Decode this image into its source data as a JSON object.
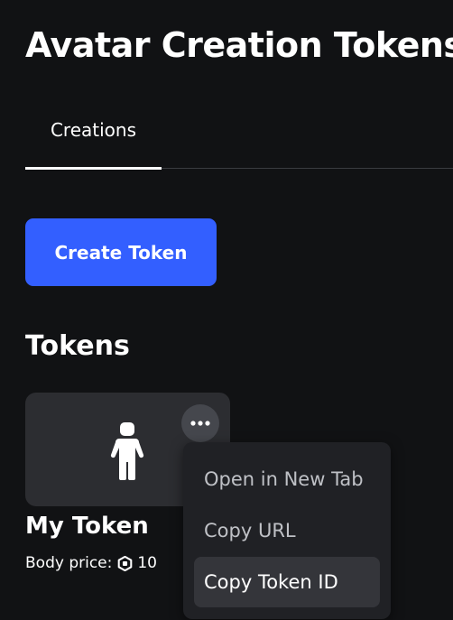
{
  "header": {
    "title": "Avatar Creation Tokens"
  },
  "tabs": [
    {
      "label": "Creations",
      "selected": true
    }
  ],
  "create_button": {
    "label": "Create Token"
  },
  "tokens_section": {
    "title": "Tokens",
    "items": [
      {
        "name": "My Token",
        "price_label": "Body price:",
        "price_value": "10",
        "icon": "avatar-body-icon",
        "currency_icon": "robux-icon"
      }
    ]
  },
  "context_menu": {
    "items": [
      {
        "label": "Open in New Tab"
      },
      {
        "label": "Copy URL"
      },
      {
        "label": "Copy Token ID",
        "highlighted": true
      }
    ]
  },
  "colors": {
    "background": "#111214",
    "accent": "#335fff",
    "card": "#2c2d31",
    "menu": "#202125"
  }
}
